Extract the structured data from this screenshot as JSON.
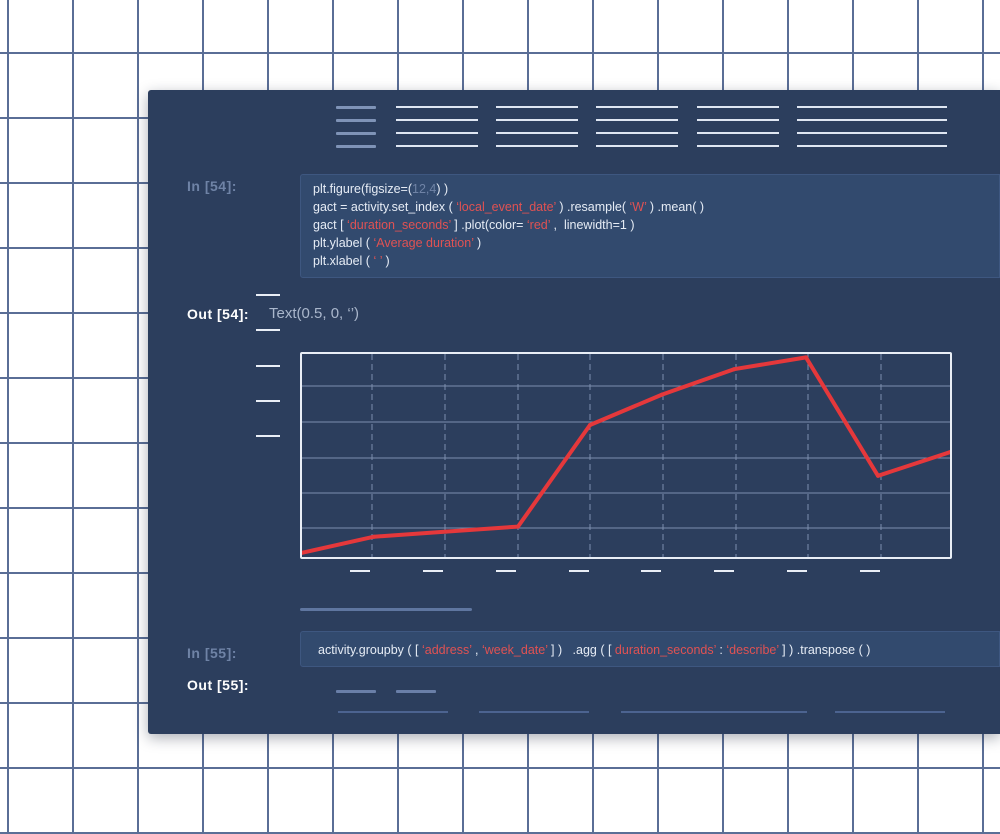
{
  "toolbar": {
    "icon": "hamburger-menu-icon",
    "menu_count": 5
  },
  "cell54": {
    "in_prompt": "In [54]:",
    "out_prompt": "Out [54]:",
    "output_text": "Text(0.5, 0, ‘’)",
    "code": [
      [
        {
          "t": "plt.figure(figsize=("
        },
        {
          "t": "12,4",
          "c": "num"
        },
        {
          "t": ") )"
        }
      ],
      [
        {
          "t": "gact = activity.set_index ( "
        },
        {
          "t": "‘local_event_date’",
          "c": "str"
        },
        {
          "t": " ) .resample( "
        },
        {
          "t": "‘W’",
          "c": "str"
        },
        {
          "t": " ) .mean( )"
        }
      ],
      [
        {
          "t": "gact [ "
        },
        {
          "t": "‘duration_seconds’",
          "c": "str"
        },
        {
          "t": " ] .plot(color= "
        },
        {
          "t": "‘red’",
          "c": "str"
        },
        {
          "t": " ,  linewidth=1 )"
        }
      ],
      [
        {
          "t": "plt.ylabel ( "
        },
        {
          "t": "‘Average duration’",
          "c": "str"
        },
        {
          "t": " )"
        }
      ],
      [
        {
          "t": "plt.xlabel ( "
        },
        {
          "t": "‘ ’",
          "c": "str"
        },
        {
          "t": " )"
        }
      ]
    ]
  },
  "cell55": {
    "in_prompt": "In [55]:",
    "out_prompt": "Out [55]:",
    "code": [
      [
        {
          "t": "activity.groupby ( [ "
        },
        {
          "t": "‘address’",
          "c": "str"
        },
        {
          "t": " , "
        },
        {
          "t": "‘week_date’",
          "c": "str"
        },
        {
          "t": " ] )   .agg ( [ "
        },
        {
          "t": "duration_seconds’",
          "c": "str"
        },
        {
          "t": " : "
        },
        {
          "t": "‘describe’",
          "c": "str"
        },
        {
          "t": " ] ) .transpose ( )"
        }
      ]
    ]
  },
  "chart_data": {
    "type": "line",
    "title": "",
    "xlabel": "",
    "ylabel": "",
    "color": "#e5383b",
    "grid": true,
    "x": [
      0,
      1,
      2,
      3,
      4,
      5,
      6,
      7,
      8,
      9
    ],
    "values": [
      0.05,
      1.0,
      1.3,
      1.6,
      7.6,
      9.4,
      10.9,
      11.6,
      4.6,
      6.0
    ],
    "xlim": [
      0,
      9
    ],
    "ylim": [
      -0.2,
      11.8
    ],
    "ytick_count": 5,
    "xtick_count": 8
  }
}
